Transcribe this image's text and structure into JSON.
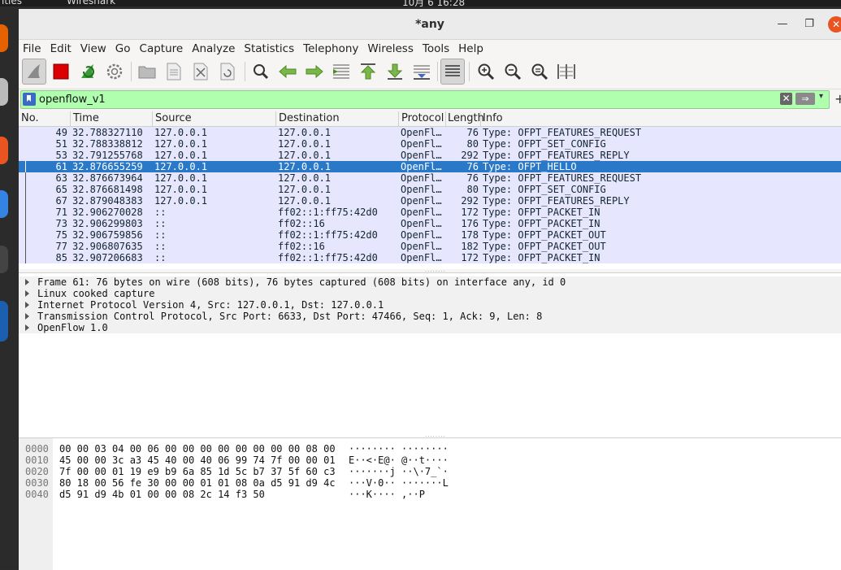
{
  "desktop": {
    "activities": "ities",
    "app_name": "Wireshark",
    "clock": "10月 6  16:28"
  },
  "window": {
    "title": "*any"
  },
  "menu": [
    "File",
    "Edit",
    "View",
    "Go",
    "Capture",
    "Analyze",
    "Statistics",
    "Telephony",
    "Wireless",
    "Tools",
    "Help"
  ],
  "toolbar": {
    "icons": [
      "shark-fin-icon",
      "stop-icon",
      "restart-icon",
      "options-gear-icon",
      "open-folder-icon",
      "file-icon",
      "close-file-icon",
      "reload-icon",
      "find-icon",
      "back-arrow-icon",
      "forward-arrow-icon",
      "go-to-packet-icon",
      "first-packet-icon",
      "last-packet-icon",
      "autoscroll-icon",
      "colorize-icon",
      "zoom-in-icon",
      "zoom-out-icon",
      "normal-size-icon",
      "resize-columns-icon"
    ]
  },
  "filter": {
    "value": "openflow_v1",
    "clear_glyph": "✕",
    "apply_glyph": "⇒",
    "dropdown_glyph": "▾",
    "add_glyph": "+"
  },
  "packet_list": {
    "columns": [
      "No.",
      "Time",
      "Source",
      "Destination",
      "Protocol",
      "Length",
      "Info"
    ],
    "rows": [
      {
        "no": "49",
        "time": "32.788327110",
        "src": "127.0.0.1",
        "dst": "127.0.0.1",
        "proto": "OpenFl…",
        "len": "76",
        "info": "Type: OFPT_FEATURES_REQUEST",
        "style": "lav",
        "line": false
      },
      {
        "no": "51",
        "time": "32.788338812",
        "src": "127.0.0.1",
        "dst": "127.0.0.1",
        "proto": "OpenFl…",
        "len": "80",
        "info": "Type: OFPT_SET_CONFIG",
        "style": "lav",
        "line": false
      },
      {
        "no": "53",
        "time": "32.791255768",
        "src": "127.0.0.1",
        "dst": "127.0.0.1",
        "proto": "OpenFl…",
        "len": "292",
        "info": "Type: OFPT_FEATURES_REPLY",
        "style": "lav",
        "line": false
      },
      {
        "no": "61",
        "time": "32.876655259",
        "src": "127.0.0.1",
        "dst": "127.0.0.1",
        "proto": "OpenFl…",
        "len": "76",
        "info": "Type: OFPT_HELLO",
        "style": "sel",
        "line": true
      },
      {
        "no": "63",
        "time": "32.876673964",
        "src": "127.0.0.1",
        "dst": "127.0.0.1",
        "proto": "OpenFl…",
        "len": "76",
        "info": "Type: OFPT_FEATURES_REQUEST",
        "style": "lav",
        "line": true
      },
      {
        "no": "65",
        "time": "32.876681498",
        "src": "127.0.0.1",
        "dst": "127.0.0.1",
        "proto": "OpenFl…",
        "len": "80",
        "info": "Type: OFPT_SET_CONFIG",
        "style": "lav",
        "line": true
      },
      {
        "no": "67",
        "time": "32.879048383",
        "src": "127.0.0.1",
        "dst": "127.0.0.1",
        "proto": "OpenFl…",
        "len": "292",
        "info": "Type: OFPT_FEATURES_REPLY",
        "style": "lav",
        "line": true
      },
      {
        "no": "71",
        "time": "32.906270028",
        "src": "::",
        "dst": "ff02::1:ff75:42d0",
        "proto": "OpenFl…",
        "len": "172",
        "info": "Type: OFPT_PACKET_IN",
        "style": "lav",
        "line": true
      },
      {
        "no": "73",
        "time": "32.906299803",
        "src": "::",
        "dst": "ff02::16",
        "proto": "OpenFl…",
        "len": "176",
        "info": "Type: OFPT_PACKET_IN",
        "style": "lav",
        "line": true
      },
      {
        "no": "75",
        "time": "32.906759856",
        "src": "::",
        "dst": "ff02::1:ff75:42d0",
        "proto": "OpenFl…",
        "len": "178",
        "info": "Type: OFPT_PACKET_OUT",
        "style": "lav",
        "line": true
      },
      {
        "no": "77",
        "time": "32.906807635",
        "src": "::",
        "dst": "ff02::16",
        "proto": "OpenFl…",
        "len": "182",
        "info": "Type: OFPT_PACKET_OUT",
        "style": "lav",
        "line": true
      },
      {
        "no": "85",
        "time": "32.907206683",
        "src": "::",
        "dst": "ff02::1:ff75:42d0",
        "proto": "OpenFl…",
        "len": "172",
        "info": "Type: OFPT_PACKET_IN",
        "style": "lav",
        "line": true
      }
    ]
  },
  "details": [
    "Frame 61: 76 bytes on wire (608 bits), 76 bytes captured (608 bits) on interface any, id 0",
    "Linux cooked capture",
    "Internet Protocol Version 4, Src: 127.0.0.1, Dst: 127.0.0.1",
    "Transmission Control Protocol, Src Port: 6633, Dst Port: 47466, Seq: 1, Ack: 9, Len: 8",
    "OpenFlow 1.0"
  ],
  "bytes": [
    {
      "off": "0000",
      "hex": "00 00 03 04 00 06 00 00  00 00 00 00 00 00 08 00",
      "ascii": "········ ········"
    },
    {
      "off": "0010",
      "hex": "45 00 00 3c a3 45 40 00  40 06 99 74 7f 00 00 01",
      "ascii": "E··<·E@· @··t····"
    },
    {
      "off": "0020",
      "hex": "7f 00 00 01 19 e9 b9 6a  85 1d 5c b7 37 5f 60 c3",
      "ascii": "·······j ··\\·7_`·"
    },
    {
      "off": "0030",
      "hex": "80 18 00 56 fe 30 00 00  01 01 08 0a d5 91 d9 4c",
      "ascii": "···V·0·· ·······L"
    },
    {
      "off": "0040",
      "hex": "d5 91 d9 4b 01 00 00 08  2c 14 f3 50",
      "ascii": "···K···· ,··P"
    }
  ]
}
